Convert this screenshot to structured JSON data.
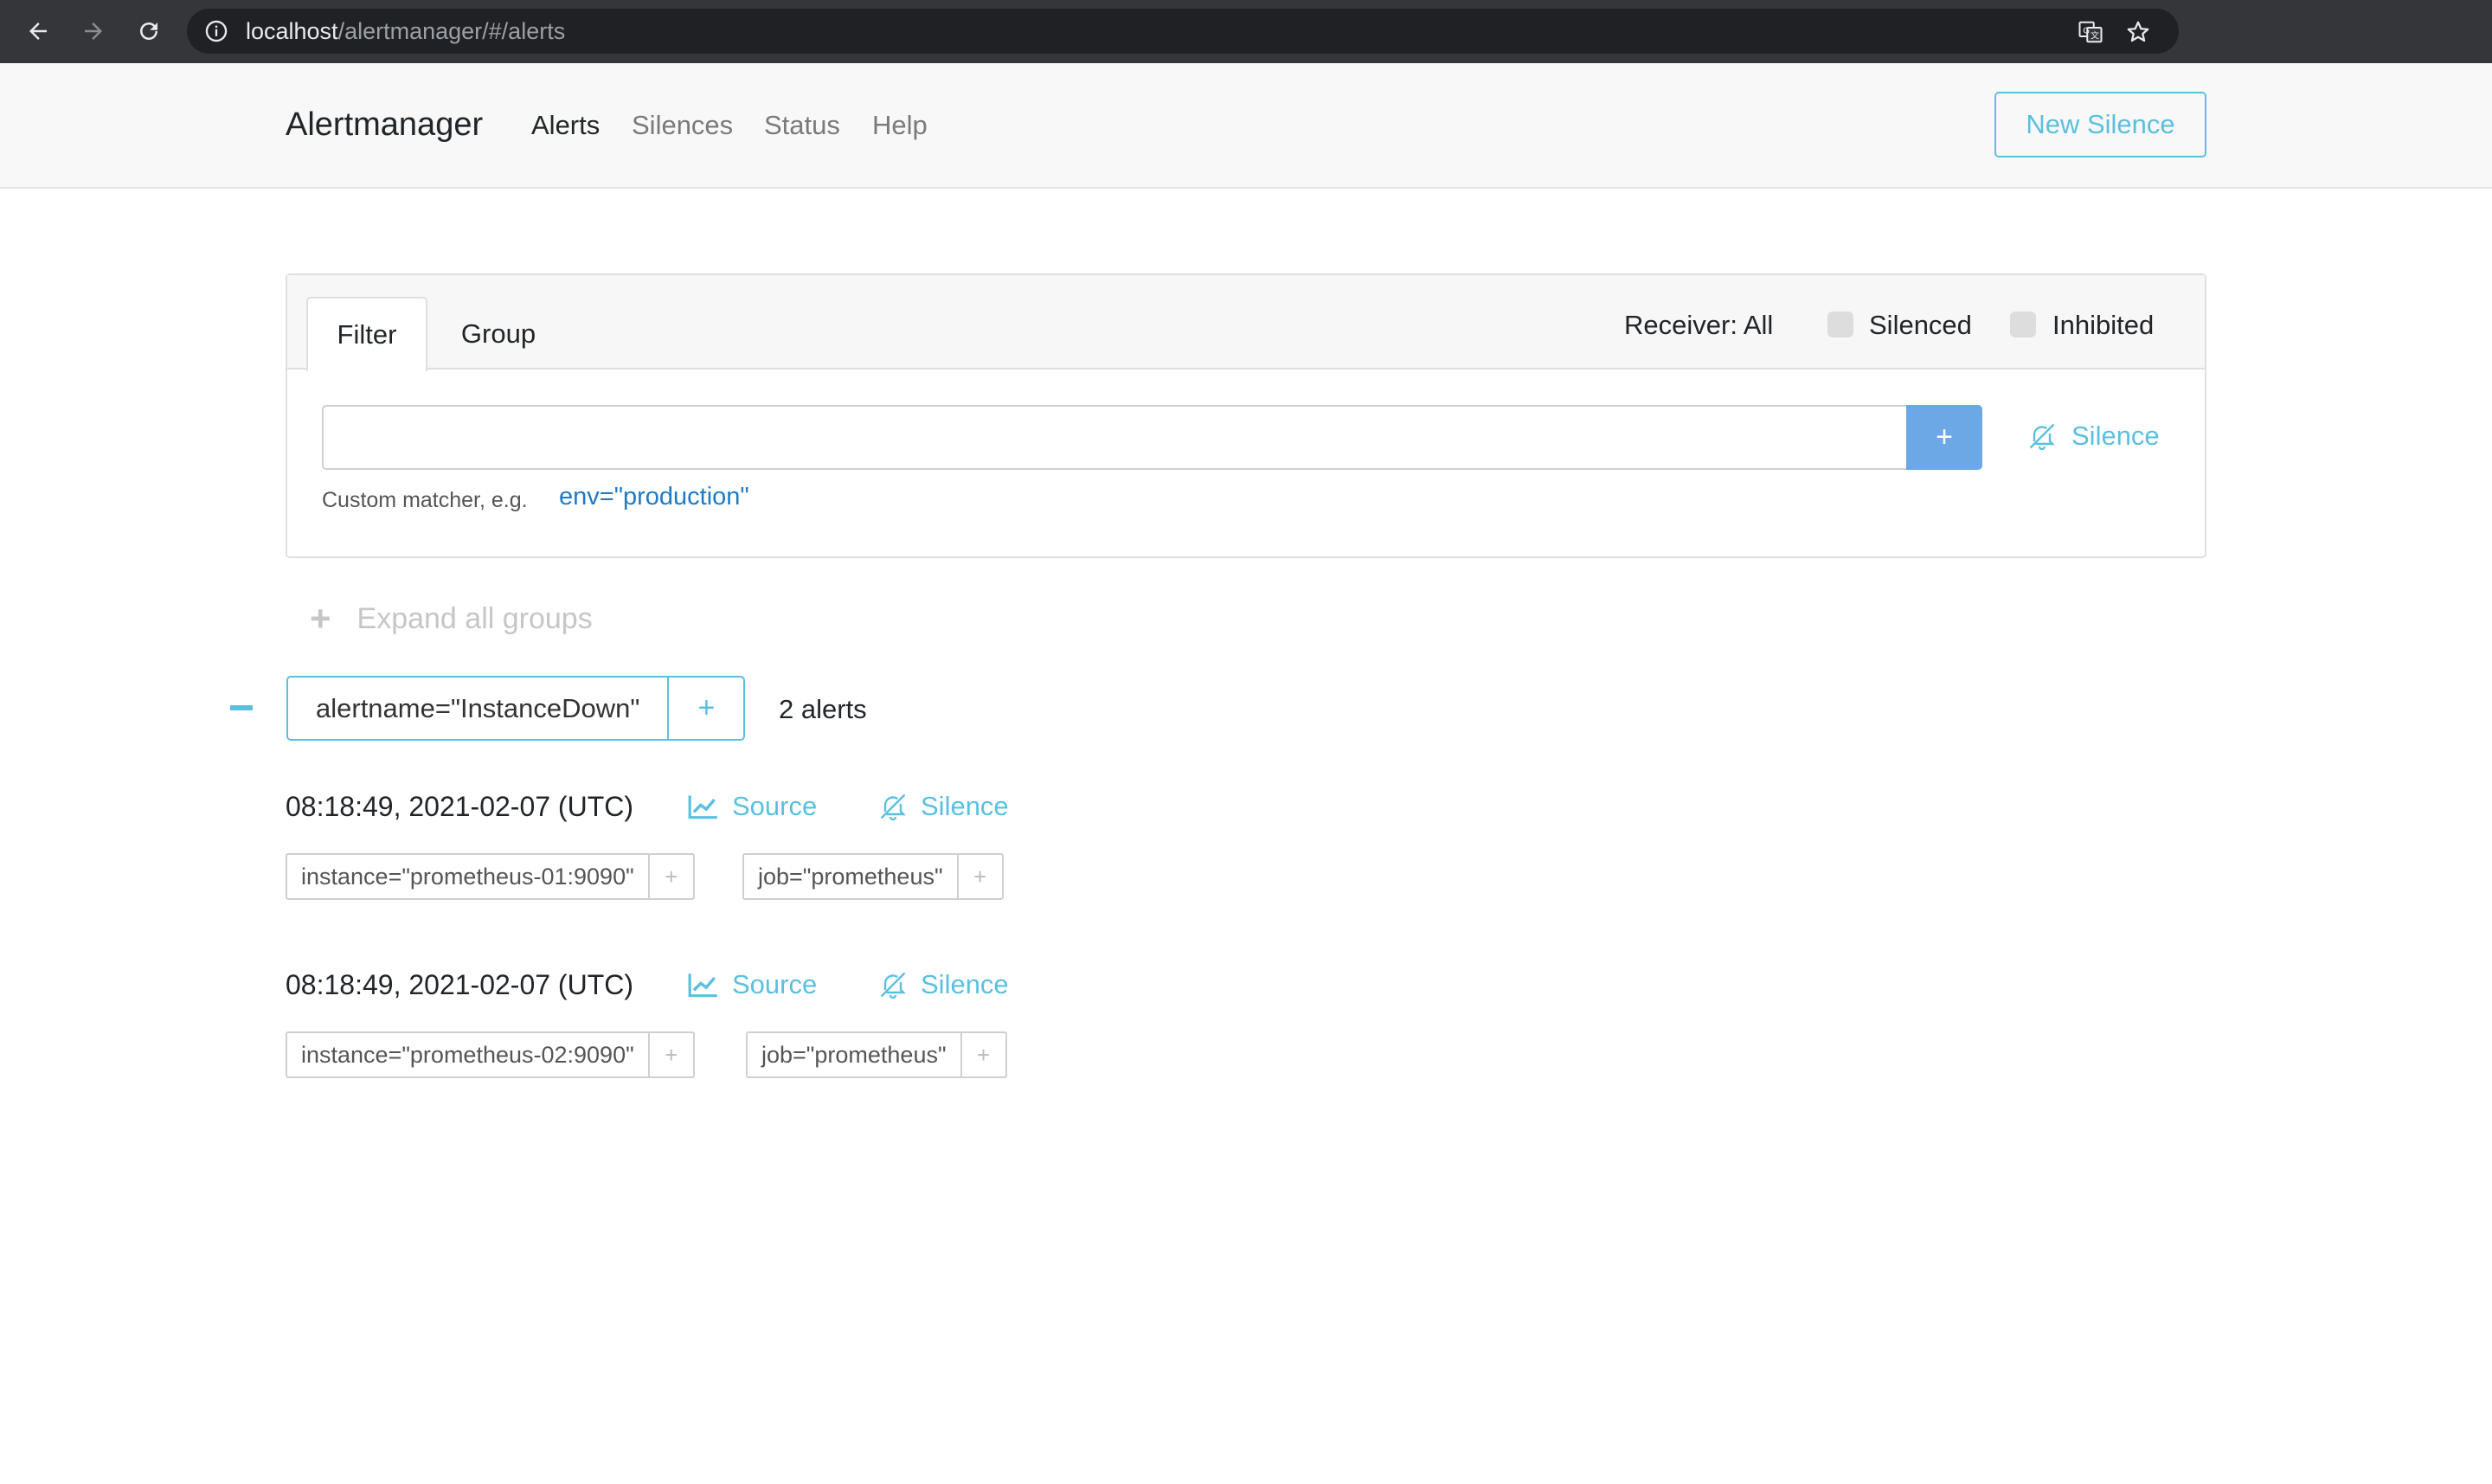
{
  "browser": {
    "url_host": "localhost",
    "url_path": "/alertmanager/#/alerts"
  },
  "navbar": {
    "brand": "Alertmanager",
    "links": [
      "Alerts",
      "Silences",
      "Status",
      "Help"
    ],
    "new_silence": "New Silence"
  },
  "filter": {
    "tabs": [
      "Filter",
      "Group"
    ],
    "receiver": "Receiver: All",
    "silenced_label": "Silenced",
    "inhibited_label": "Inhibited",
    "input_value": "",
    "add_button": "+",
    "silence_link": "Silence",
    "hint_text": "Custom matcher, e.g.",
    "hint_example": "env=\"production\""
  },
  "expand_all": {
    "icon": "+",
    "label": "Expand all groups"
  },
  "group": {
    "label": "alertname=\"InstanceDown\"",
    "add": "+",
    "count": "2 alerts",
    "alerts": [
      {
        "time": "08:18:49, 2021-02-07 (UTC)",
        "source": "Source",
        "silence": "Silence",
        "labels": [
          {
            "text": "instance=\"prometheus-01:9090\"",
            "add": "+"
          },
          {
            "text": "job=\"prometheus\"",
            "add": "+"
          }
        ]
      },
      {
        "time": "08:18:49, 2021-02-07 (UTC)",
        "source": "Source",
        "silence": "Silence",
        "labels": [
          {
            "text": "instance=\"prometheus-02:9090\"",
            "add": "+"
          },
          {
            "text": "job=\"prometheus\"",
            "add": "+"
          }
        ]
      }
    ]
  },
  "colors": {
    "accent": "#5bc0de",
    "primary_button": "#6ca8e6",
    "link_code": "#1f7ac2"
  }
}
